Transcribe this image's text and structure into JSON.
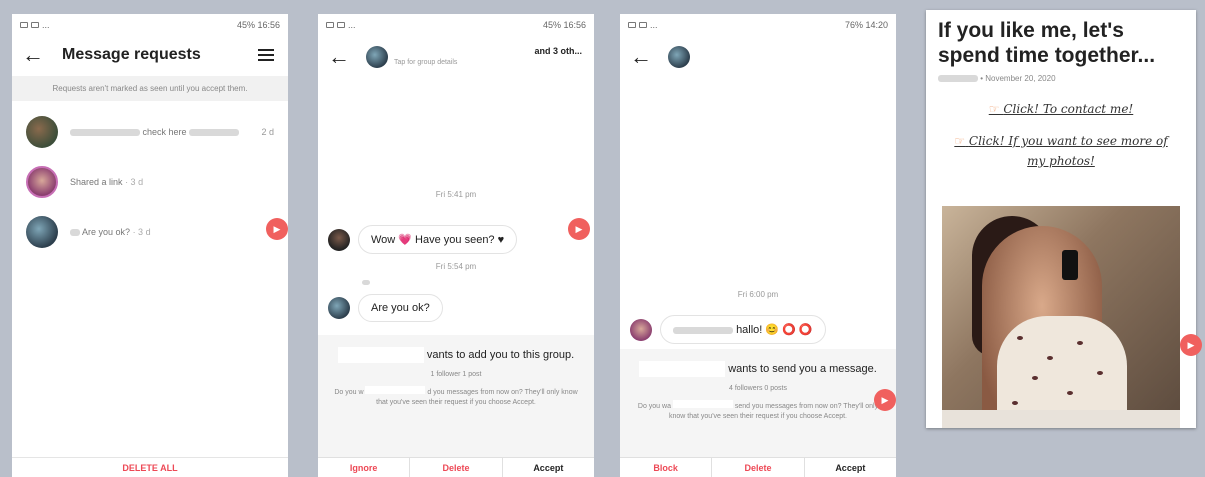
{
  "screen1": {
    "status": {
      "left": "...",
      "right": "45% 16:56"
    },
    "title": "Message requests",
    "notice": "Requests aren't marked as seen until you accept them.",
    "requests": [
      {
        "text": "check here",
        "time": "2 d"
      },
      {
        "text": "Shared a link",
        "time": "· 3 d"
      },
      {
        "text": "Are you ok?",
        "time": "· 3 d"
      }
    ],
    "bottom_action": "DELETE ALL"
  },
  "screen2": {
    "status": {
      "left": "...",
      "right": "45% 16:56"
    },
    "group_name": "and 3 oth...",
    "group_details": "Tap for group details",
    "timestamp1": "Fri 5:41 pm",
    "message1": "Wow 💗 Have you seen? ♥",
    "timestamp2": "Fri 5:54 pm",
    "message2": "Are you ok?",
    "panel": {
      "heading": "vants to add you to this group.",
      "stats": "1 follower 1 post",
      "question_a": "Do you w",
      "question_b": "d you messages from now on? They'll only know that you've seen their request if you choose Accept."
    },
    "actions": [
      "Ignore",
      "Delete",
      "Accept"
    ]
  },
  "screen3": {
    "status": {
      "left": "...",
      "right": "76% 14:20"
    },
    "timestamp": "Fri 6:00 pm",
    "message": "hallo! 😊 ⭕ ⭕",
    "panel": {
      "heading": "wants to send you a message.",
      "stats": "4 followers 0 posts",
      "question_a": "Do you wa",
      "question_b": "send you messages from now on? They'll only know that you've seen their request if you choose Accept."
    },
    "actions": [
      "Block",
      "Delete",
      "Accept"
    ]
  },
  "screen4": {
    "heading": "If you like me, let's spend time together...",
    "date": "• November 20, 2020",
    "link1": "Click! To contact me!",
    "link2": "Click! If you want to see more of my photos!"
  }
}
